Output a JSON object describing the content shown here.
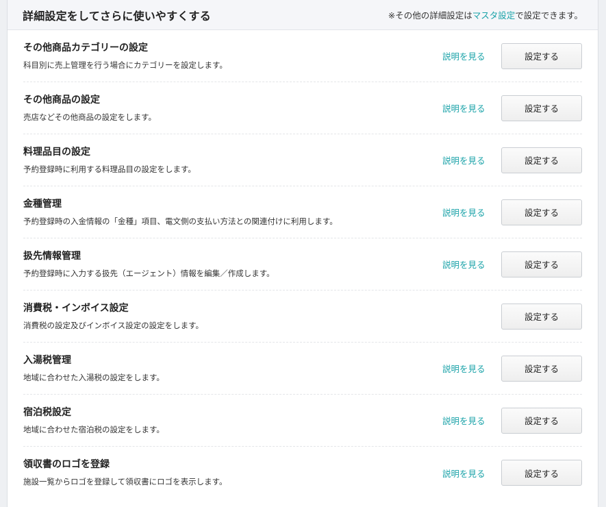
{
  "header": {
    "title": "詳細設定をしてさらに使いやすくする",
    "note_prefix": "※その他の詳細設定は",
    "note_link": "マスタ設定",
    "note_suffix": "で設定できます。"
  },
  "labels": {
    "help": "説明を見る",
    "set": "設定する"
  },
  "rows": [
    {
      "title": "その他商品カテゴリーの設定",
      "desc": "科目別に売上管理を行う場合にカテゴリーを設定します。",
      "has_help": true
    },
    {
      "title": "その他商品の設定",
      "desc": "売店などその他商品の設定をします。",
      "has_help": true
    },
    {
      "title": "料理品目の設定",
      "desc": "予約登録時に利用する料理品目の設定をします。",
      "has_help": true
    },
    {
      "title": "金種管理",
      "desc": "予約登録時の入金情報の「金種」項目、電文側の支払い方法との関連付けに利用します。",
      "has_help": true
    },
    {
      "title": "扱先情報管理",
      "desc": "予約登録時に入力する扱先（エージェント）情報を編集／作成します。",
      "has_help": true
    },
    {
      "title": "消費税・インボイス設定",
      "desc": "消費税の設定及びインボイス設定の設定をします。",
      "has_help": false
    },
    {
      "title": "入湯税管理",
      "desc": "地域に合わせた入湯税の設定をします。",
      "has_help": true
    },
    {
      "title": "宿泊税設定",
      "desc": "地域に合わせた宿泊税の設定をします。",
      "has_help": true
    },
    {
      "title": "領収書のロゴを登録",
      "desc": "施設一覧からロゴを登録して領収書にロゴを表示します。",
      "has_help": true
    }
  ]
}
